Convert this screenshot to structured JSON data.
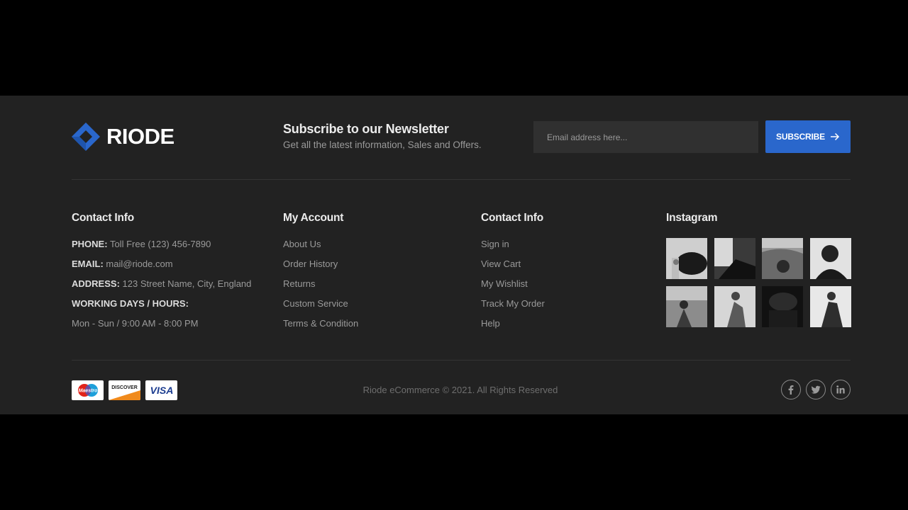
{
  "brand": {
    "name": "RIODE",
    "accent_color": "#2a67cc"
  },
  "newsletter": {
    "title": "Subscribe to our Newsletter",
    "subtitle": "Get all the latest information, Sales and Offers.",
    "email_placeholder": "Email address here...",
    "button_label": "SUBSCRIBE",
    "button_icon": "arrow-right-icon"
  },
  "contact": {
    "heading": "Contact Info",
    "phone_label": "PHONE:",
    "phone_value": "Toll Free (123) 456-7890",
    "email_label": "EMAIL:",
    "email_value": "mail@riode.com",
    "address_label": "ADDRESS:",
    "address_value": "123 Street Name, City, England",
    "hours_label": "WORKING DAYS / HOURS:",
    "hours_value": "Mon - Sun / 9:00 AM - 8:00 PM"
  },
  "account": {
    "heading": "My Account",
    "links": [
      "About Us",
      "Order History",
      "Returns",
      "Custom Service",
      "Terms & Condition"
    ]
  },
  "contact2": {
    "heading": "Contact Info",
    "links": [
      "Sign in",
      "View Cart",
      "My Wishlist",
      "Track My Order",
      "Help"
    ]
  },
  "instagram": {
    "heading": "Instagram",
    "photo_count": 8
  },
  "footer_bottom": {
    "payments": [
      {
        "name": "maestro-icon",
        "label": "Maestro"
      },
      {
        "name": "discover-icon",
        "label": "DISCOVER"
      },
      {
        "name": "visa-icon",
        "label": "VISA"
      }
    ],
    "copyright": "Riode eCommerce © 2021. All Rights Reserved",
    "social": [
      "facebook-icon",
      "twitter-icon",
      "linkedin-icon"
    ]
  }
}
